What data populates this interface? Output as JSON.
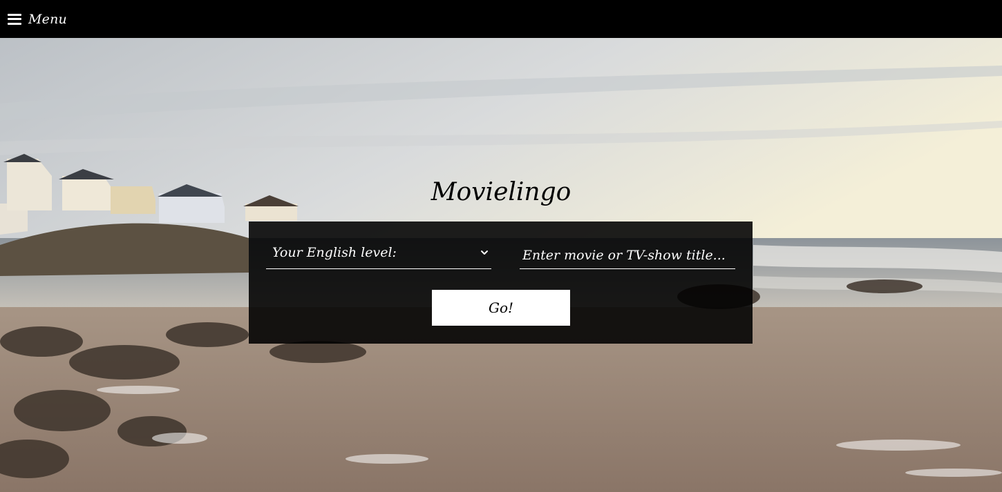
{
  "topbar": {
    "menu_icon": "hamburger-icon",
    "menu_label": "Menu"
  },
  "hero": {
    "title": "Movielingo"
  },
  "form": {
    "level_select_label": "Your English level:",
    "level_icon": "chevron-down-icon",
    "title_placeholder": "Enter movie or TV-show title...",
    "title_value": "",
    "go_label": "Go!"
  },
  "colors": {
    "topbar": "#000000",
    "panel": "#111111",
    "button": "#ffffff",
    "text_light": "#ffffff",
    "text_dark": "#000000"
  }
}
